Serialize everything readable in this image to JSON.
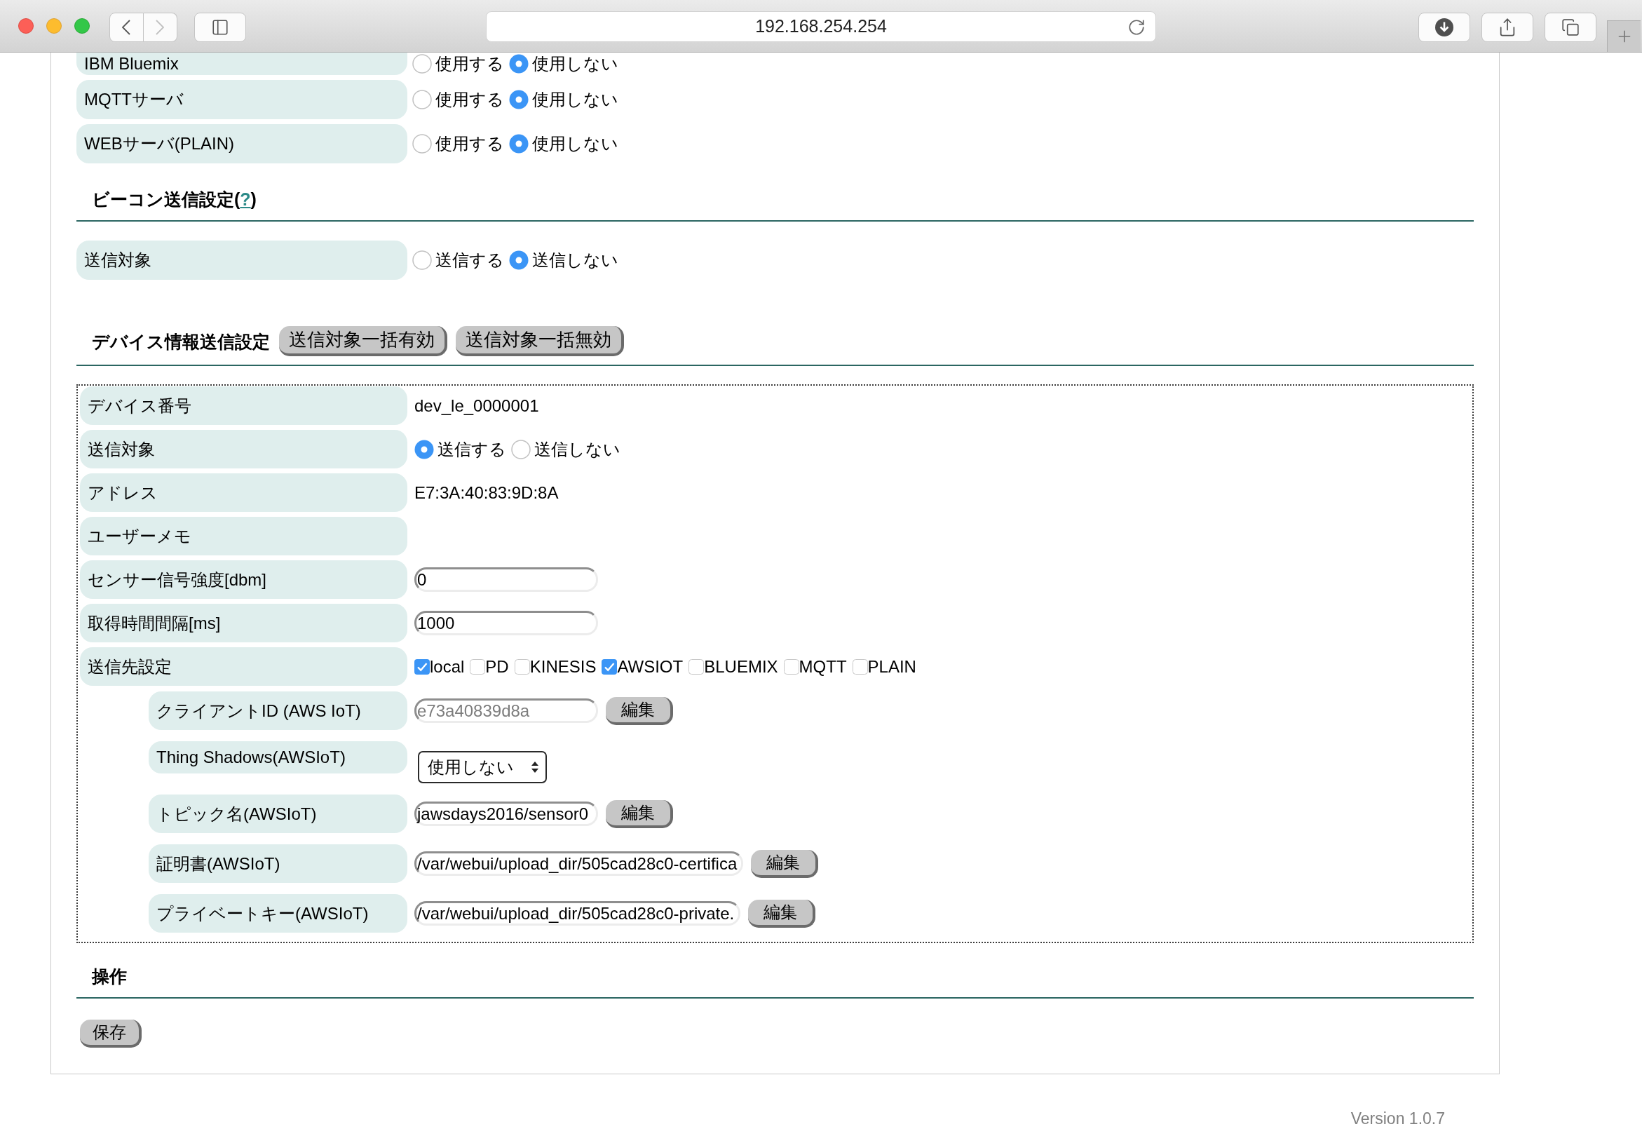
{
  "browser": {
    "address": "192.168.254.254",
    "back": {
      "disabled": false
    },
    "forward": {
      "disabled": true
    }
  },
  "server_settings": {
    "rows": [
      {
        "label": "IBM Bluemix",
        "options": [
          {
            "label": "使用する",
            "selected": false
          },
          {
            "label": "使用しない",
            "selected": true
          }
        ]
      },
      {
        "label": "MQTTサーバ",
        "options": [
          {
            "label": "使用する",
            "selected": false
          },
          {
            "label": "使用しない",
            "selected": true
          }
        ]
      },
      {
        "label": "WEBサーバ(PLAIN)",
        "options": [
          {
            "label": "使用する",
            "selected": false
          },
          {
            "label": "使用しない",
            "selected": true
          }
        ]
      }
    ]
  },
  "beacon_section": {
    "title": "ビーコン送信設定(",
    "help_link": "?",
    "title_end": ")",
    "rows": [
      {
        "label": "送信対象",
        "options": [
          {
            "label": "送信する",
            "selected": false
          },
          {
            "label": "送信しない",
            "selected": true
          }
        ]
      }
    ]
  },
  "device_section": {
    "title": "デバイス情報送信設定",
    "buttons": [
      "送信対象一括有効",
      "送信対象一括無効"
    ],
    "rows": [
      {
        "kind": "text",
        "label": "デバイス番号",
        "value": "dev_le_0000001"
      },
      {
        "kind": "radio",
        "label": "送信対象",
        "options": [
          {
            "label": "送信する",
            "selected": true
          },
          {
            "label": "送信しない",
            "selected": false
          }
        ]
      },
      {
        "kind": "text",
        "label": "アドレス",
        "value": "E7:3A:40:83:9D:8A"
      },
      {
        "kind": "text",
        "label": "ユーザーメモ"
      },
      {
        "kind": "input",
        "label": "センサー信号強度[dbm]",
        "value": "0"
      },
      {
        "kind": "input",
        "label": "取得時間間隔[ms]",
        "value": "1000"
      },
      {
        "kind": "checkboxes",
        "label": "送信先設定",
        "options": [
          {
            "label": "local",
            "checked": true
          },
          {
            "label": "PD",
            "checked": false
          },
          {
            "label": "KINESIS",
            "checked": false
          },
          {
            "label": "AWSIOT",
            "checked": true
          },
          {
            "label": "BLUEMIX",
            "checked": false
          },
          {
            "label": "MQTT",
            "checked": false
          },
          {
            "label": "PLAIN",
            "checked": false
          }
        ],
        "children": [
          {
            "kind": "input",
            "label": "クライアントID (AWS IoT)",
            "placeholder": "e73a40839d8a",
            "button": "編集"
          },
          {
            "kind": "select",
            "label": "Thing Shadows(AWSIoT)",
            "value": "使用しない"
          },
          {
            "kind": "input",
            "label": "トピック名(AWSIoT)",
            "value": "jawsdays2016/sensor0",
            "button": "編集"
          },
          {
            "kind": "long_input",
            "label": "証明書(AWSIoT)",
            "value": "/var/webui/upload_dir/505cad28c0-certifica",
            "button": "編集"
          },
          {
            "kind": "long_input",
            "label": "プライベートキー(AWSIoT)",
            "value": "/var/webui/upload_dir/505cad28c0-private.",
            "button": "編集"
          }
        ]
      }
    ]
  },
  "operations_section": {
    "title": "操作",
    "buttons": [
      "保存"
    ]
  },
  "footer": {
    "version": "Version 1.0.7"
  }
}
